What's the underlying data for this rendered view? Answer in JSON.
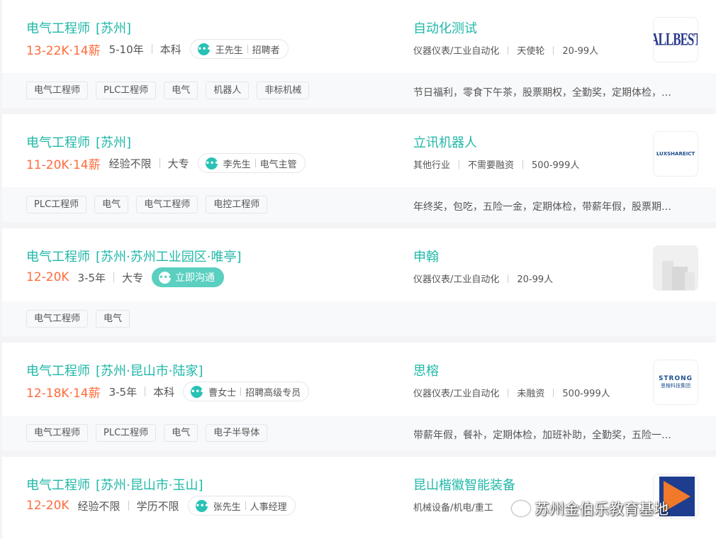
{
  "jobs": [
    {
      "title": "电气工程师",
      "area": "[苏州]",
      "salary": "13-22K·14薪",
      "experience": "5-10年",
      "education": "本科",
      "recruiter_name": "王先生",
      "recruiter_role": "招聘者",
      "company": "自动化测试",
      "company_info": [
        "仪器仪表/工业自动化",
        "天使轮",
        "20-99人"
      ],
      "logo": "ALLBEST",
      "tags": [
        "电气工程师",
        "PLC工程师",
        "电气",
        "机器人",
        "非标机械"
      ],
      "welfare": "节日福利，零食下午茶，股票期权，全勤奖，定期体检，…"
    },
    {
      "title": "电气工程师",
      "area": "[苏州]",
      "salary": "11-20K·14薪",
      "experience": "经验不限",
      "education": "大专",
      "recruiter_name": "李先生",
      "recruiter_role": "电气主管",
      "company": "立讯机器人",
      "company_info": [
        "其他行业",
        "不需要融资",
        "500-999人"
      ],
      "logo": "LUXSHAREICT",
      "tags": [
        "PLC工程师",
        "电气",
        "电气工程师",
        "电控工程师"
      ],
      "welfare": "年终奖，包吃，五险一金，定期体检，带薪年假，股票期…"
    },
    {
      "title": "电气工程师",
      "area": "[苏州·苏州工业园区·唯亭]",
      "salary": "12-20K",
      "experience": "3-5年",
      "education": "大专",
      "chat_label": "立即沟通",
      "company": "申翰",
      "company_info": [
        "仪器仪表/工业自动化",
        "20-99人"
      ],
      "logo": "",
      "tags": [
        "电气工程师",
        "电气"
      ],
      "welfare": ""
    },
    {
      "title": "电气工程师",
      "area": "[苏州·昆山市·陆家]",
      "salary": "12-18K·14薪",
      "experience": "3-5年",
      "education": "本科",
      "recruiter_name": "曹女士",
      "recruiter_role": "招聘高级专员",
      "company": "思榕",
      "company_info": [
        "仪器仪表/工业自动化",
        "未融资",
        "500-999人"
      ],
      "logo": "STRONG",
      "logo_sub": "思榕科技集团",
      "tags": [
        "电气工程师",
        "PLC工程师",
        "电气",
        "电子半导体"
      ],
      "welfare": "带薪年假，餐补，定期体检，加班补助，全勤奖，五险一…"
    },
    {
      "title": "电气工程师",
      "area": "[苏州·昆山市·玉山]",
      "salary": "12-20K",
      "experience": "经验不限",
      "education": "学历不限",
      "recruiter_name": "张先生",
      "recruiter_role": "人事经理",
      "company": "昆山楷徽智能装备",
      "company_info": [
        "机械设备/机电/重工"
      ],
      "logo": "",
      "tags": [],
      "welfare": ""
    }
  ],
  "watermark": "苏州金伯乐教育基地",
  "colors": {
    "accent": "#20b8a8",
    "salary": "#fd6c3c",
    "chat_button": "#5bcfc0"
  }
}
